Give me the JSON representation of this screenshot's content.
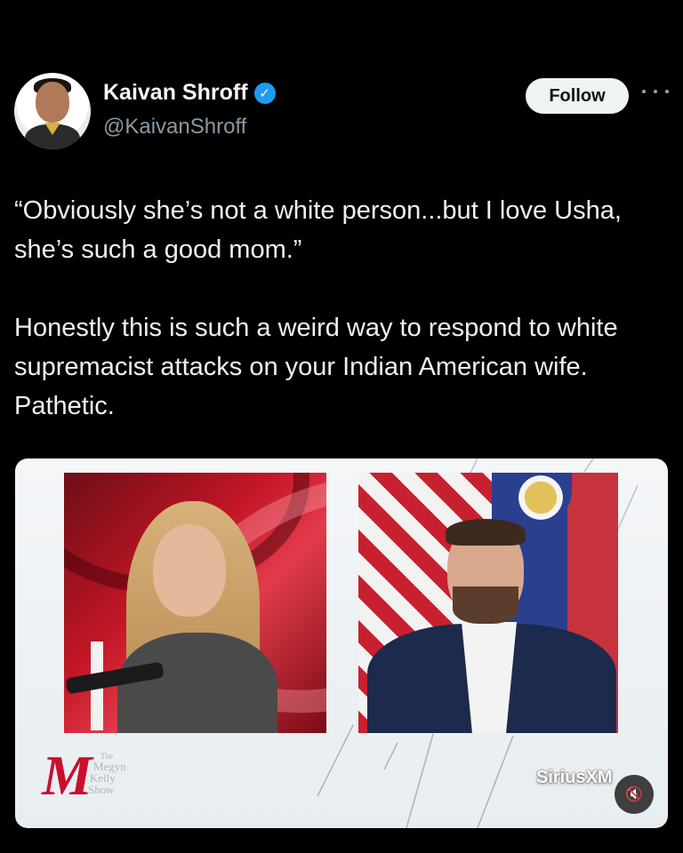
{
  "author": {
    "name": "Kaivan Shroff",
    "handle": "@KaivanShroff",
    "verified_icon": "verified-badge-icon",
    "verified_color": "#1d9bf0"
  },
  "actions": {
    "follow_label": "Follow",
    "more_icon": "more-options-icon"
  },
  "tweet": {
    "paragraphs": [
      "“Obviously she’s not a white person...but I love Usha, she’s such a good mom.”",
      "Honestly this is such a weird way to respond to white supremacist attacks on your Indian American wife. Pathetic."
    ]
  },
  "media": {
    "logo_mark": "M",
    "logo_lines": [
      "The",
      "Megyn",
      "Kelly",
      "Show"
    ],
    "watermark": "SiriusXM",
    "mute_icon": "speaker-muted-icon",
    "accent_color": "#c8102e"
  }
}
